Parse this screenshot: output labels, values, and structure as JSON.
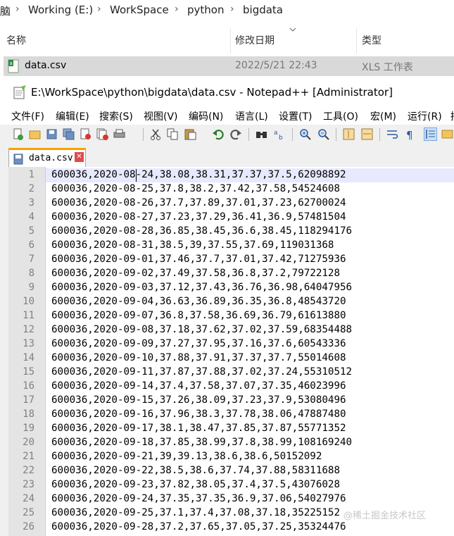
{
  "explorer": {
    "breadcrumb": [
      "脑",
      "Working (E:)",
      "WorkSpace",
      "python",
      "bigdata"
    ],
    "columns": {
      "name": "名称",
      "modified": "修改日期",
      "type": "类型"
    },
    "file": {
      "name": "data.csv",
      "modified": "2022/5/21 22:43",
      "type": "XLS 工作表"
    }
  },
  "npp": {
    "title": "E:\\WorkSpace\\python\\bigdata\\data.csv - Notepad++ [Administrator]",
    "menus": [
      "文件(F)",
      "编辑(E)",
      "搜索(S)",
      "视图(V)",
      "编码(N)",
      "语言(L)",
      "设置(T)",
      "工具(O)",
      "宏(M)",
      "运行(R)",
      "插"
    ],
    "toolbar_icons": [
      "new-file-icon",
      "open-file-icon",
      "save-icon",
      "save-all-icon",
      "close-icon",
      "close-all-icon",
      "print-icon",
      "cut-icon",
      "copy-icon",
      "paste-icon",
      "undo-icon",
      "redo-icon",
      "find-icon",
      "replace-icon",
      "zoom-in-icon",
      "zoom-out-icon",
      "sync-vertical-icon",
      "sync-horizontal-icon",
      "word-wrap-icon",
      "show-all-chars-icon",
      "indent-guide-icon",
      "udl-icon"
    ],
    "tab": {
      "label": "data.csv",
      "close": "✕"
    },
    "lines": [
      "600036,2020-08-24,38.08,38.31,37.37,37.5,62098892",
      "600036,2020-08-25,37.8,38.2,37.42,37.58,54524608",
      "600036,2020-08-26,37.7,37.89,37.01,37.23,62700024",
      "600036,2020-08-27,37.23,37.29,36.41,36.9,57481504",
      "600036,2020-08-28,36.85,38.45,36.6,38.45,118294176",
      "600036,2020-08-31,38.5,39,37.55,37.69,119031368",
      "600036,2020-09-01,37.46,37.7,37.01,37.42,71275936",
      "600036,2020-09-02,37.49,37.58,36.8,37.2,79722128",
      "600036,2020-09-03,37.12,37.43,36.76,36.98,64047956",
      "600036,2020-09-04,36.63,36.89,36.35,36.8,48543720",
      "600036,2020-09-07,36.8,37.58,36.69,36.79,61613880",
      "600036,2020-09-08,37.18,37.62,37.02,37.59,68354488",
      "600036,2020-09-09,37.27,37.95,37.16,37.6,60543336",
      "600036,2020-09-10,37.88,37.91,37.37,37.7,55014608",
      "600036,2020-09-11,37.87,37.88,37.02,37.24,55310512",
      "600036,2020-09-14,37.4,37.58,37.07,37.35,46023996",
      "600036,2020-09-15,37.26,38.09,37.23,37.9,53080496",
      "600036,2020-09-16,37.96,38.3,37.78,38.06,47887480",
      "600036,2020-09-17,38.1,38.47,37.85,37.87,55771352",
      "600036,2020-09-18,37.85,38.99,37.8,38.99,108169240",
      "600036,2020-09-21,39,39.13,38.6,38.6,50152092",
      "600036,2020-09-22,38.5,38.6,37.74,37.88,58311688",
      "600036,2020-09-23,37.82,38.05,37.4,37.5,43076028",
      "600036,2020-09-24,37.35,37.35,36.9,37.06,54027976",
      "600036,2020-09-25,37.1,37.4,37.08,37.18,35225152",
      "600036,2020-09-28,37.2,37.65,37.05,37.25,35324476"
    ],
    "watermark": "@稀土掘金技术社区"
  }
}
